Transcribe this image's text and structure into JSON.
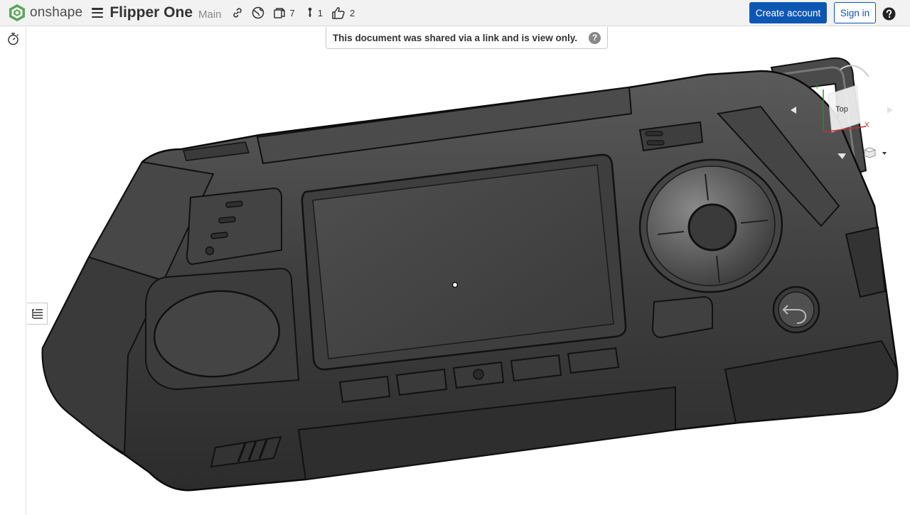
{
  "header": {
    "logo_text": "onshape",
    "doc_title": "Flipper One",
    "branch": "Main",
    "versions_count": "7",
    "branches_count": "1",
    "likes_count": "2",
    "create_account_label": "Create account",
    "sign_in_label": "Sign in"
  },
  "banner": {
    "message": "This document was shared via a link and is view only.",
    "help_glyph": "?"
  },
  "view_cube": {
    "face_label": "Top",
    "axis_y": "Y",
    "axis_x": "X"
  },
  "icons": [
    "onshape-logo-icon",
    "hamburger-menu-icon",
    "link-icon",
    "globe-icon",
    "versions-icon",
    "branch-icon",
    "like-icon",
    "help-icon",
    "stopwatch-icon",
    "feature-tree-icon",
    "view-options-icon"
  ],
  "colors": {
    "primary_button": "#0d57b4",
    "topbar_bg": "#f2f2f2",
    "logo_green": "#4a9a4a",
    "model_body": "#3d3d3d"
  }
}
